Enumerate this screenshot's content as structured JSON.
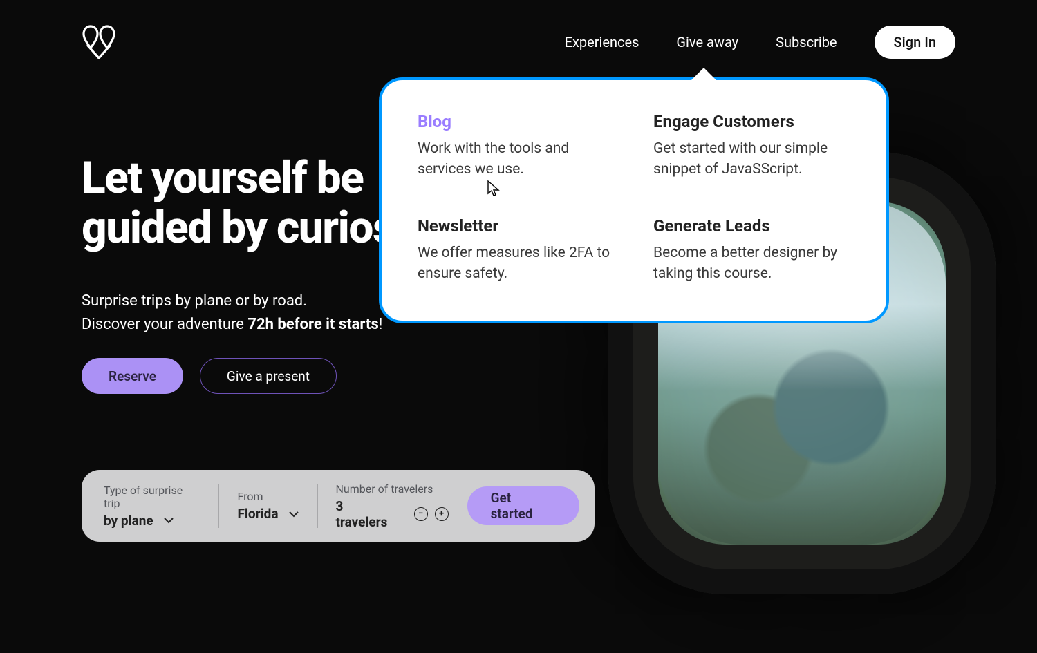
{
  "colors": {
    "accent": "#ab91f5",
    "dropdown_border": "#0098ff",
    "link_active": "#9a7dff"
  },
  "nav": {
    "items": [
      "Experiences",
      "Give away",
      "Subscribe"
    ],
    "signin": "Sign In"
  },
  "dropdown": {
    "items": [
      {
        "title": "Blog",
        "desc": "Work with the tools and services we use.",
        "active": true
      },
      {
        "title": "Engage Customers",
        "desc": "Get started with our simple snippet of JavaSScript."
      },
      {
        "title": "Newsletter",
        "desc": "We offer measures like 2FA to ensure safety."
      },
      {
        "title": "Generate Leads",
        "desc": "Become a better designer by taking this course."
      }
    ]
  },
  "hero": {
    "headline_line1": "Let yourself be",
    "headline_line2": "guided by curiosity",
    "sub_line1": "Surprise trips by plane or by road.",
    "sub_line2_a": "Discover your adventure ",
    "sub_line2_b": "72h before it starts",
    "sub_line2_c": "!",
    "cta_primary": "Reserve",
    "cta_secondary": "Give a present"
  },
  "booking": {
    "type": {
      "label": "Type of surprise trip",
      "value": "by plane"
    },
    "from": {
      "label": "From",
      "value": "Florida"
    },
    "travelers": {
      "label": "Number of travelers",
      "value": "3 travelers"
    },
    "go": "Get started"
  }
}
